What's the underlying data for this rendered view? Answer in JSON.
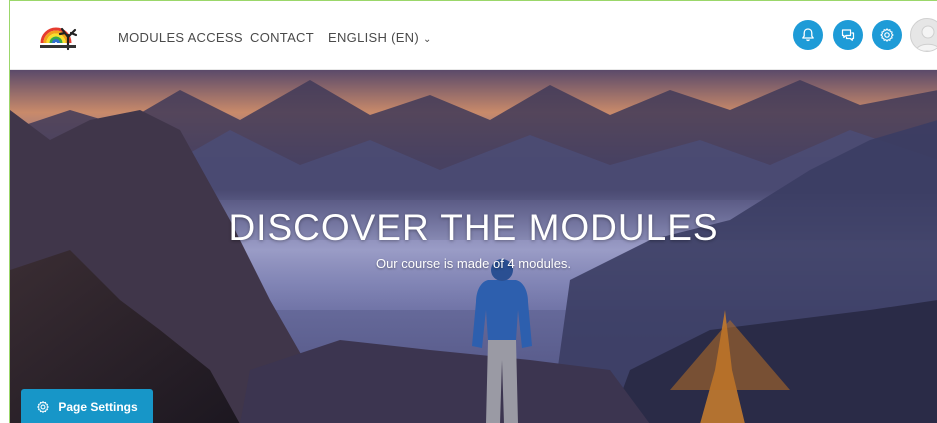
{
  "nav": {
    "modules_access": "MODULES ACCESS",
    "contact": "CONTACT",
    "language": "ENGLISH (EN)",
    "language_chevron": "⌄"
  },
  "header_icons": [
    {
      "name": "notifications-icon"
    },
    {
      "name": "messages-icon"
    },
    {
      "name": "settings-icon"
    }
  ],
  "hero": {
    "title": "DISCOVER THE MODULES",
    "subtitle": "Our course is made of 4 modules."
  },
  "page_settings": {
    "label": "Page Settings"
  },
  "colors": {
    "accent": "#1e9bd7",
    "page_settings_bg": "#1796c8"
  }
}
